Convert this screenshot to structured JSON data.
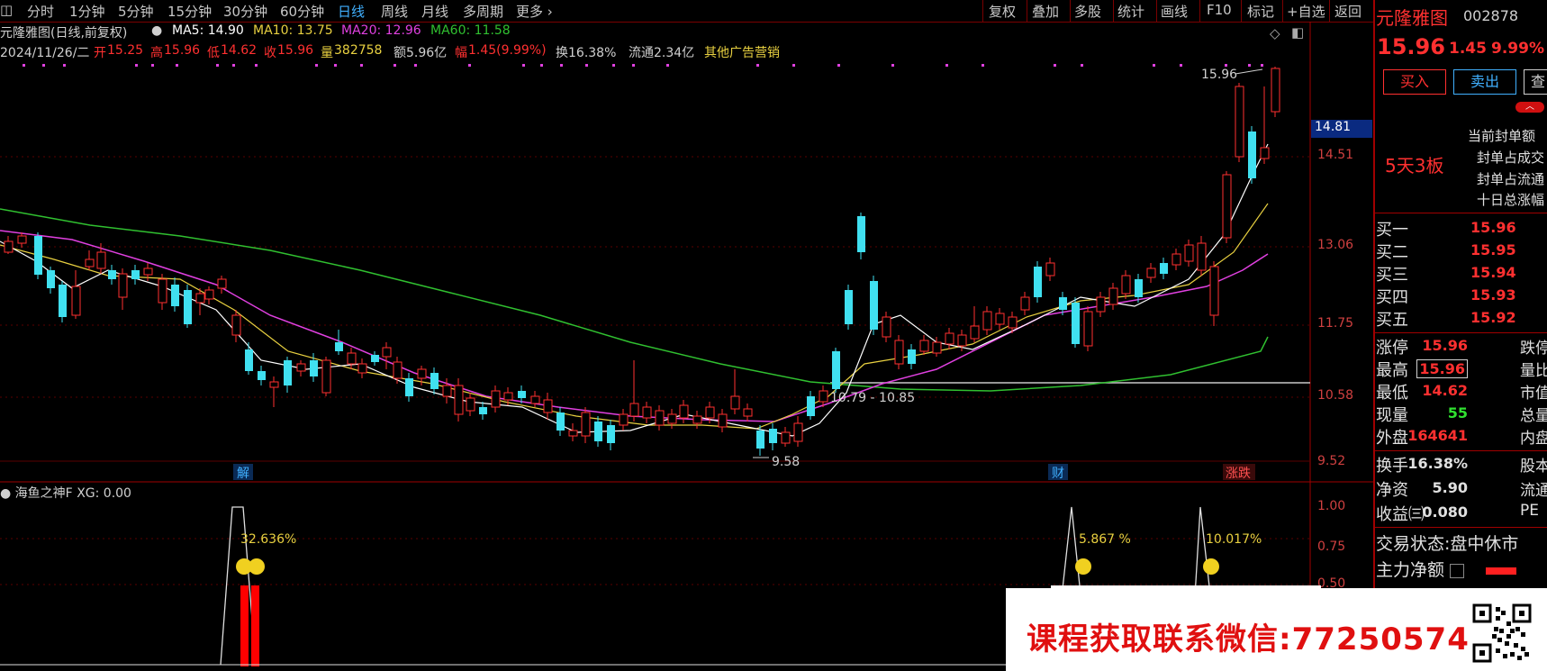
{
  "topbar": {
    "periods": [
      "分时",
      "1分钟",
      "5分钟",
      "15分钟",
      "30分钟",
      "60分钟",
      "日线",
      "周线",
      "月线",
      "多周期",
      "更多"
    ],
    "active_period": "日线",
    "tools": [
      "复权",
      "叠加",
      "多股",
      "统计",
      "画线",
      "F10",
      "标记",
      "+自选",
      "返回"
    ]
  },
  "legend": {
    "name": "元隆雅图(日线,前复权)",
    "ma5": "MA5: 14.90",
    "ma10": "MA10: 13.75",
    "ma20": "MA20: 12.96",
    "ma60": "MA60: 11.58"
  },
  "info": {
    "date": "2024/11/26/二",
    "open_label": "开",
    "open": "15.25",
    "high_label": "高",
    "high": "15.96",
    "low_label": "低",
    "low": "14.62",
    "close_label": "收",
    "close": "15.96",
    "vol_label": "量",
    "vol": "382758",
    "amount": "额5.96亿",
    "change_label": "幅",
    "change": "1.45(9.99%)",
    "turnover": "换16.38%",
    "float": "流通2.34亿",
    "ad": "其他广告营销"
  },
  "price_axis": {
    "ticks": [
      "14.51",
      "13.06",
      "11.75",
      "10.58",
      "9.52"
    ],
    "current": "14.81"
  },
  "annotations": {
    "high_label": "15.96",
    "low_label": "9.58",
    "range_label": "10.79 - 10.85",
    "markers": [
      "解",
      "财",
      "涨跌"
    ]
  },
  "indicator": {
    "name": "海鱼之神F",
    "value": "XG: 0.00",
    "ticks": [
      "1.00",
      "0.75",
      "0.50"
    ],
    "labels": [
      "32.636%",
      "5.867 %",
      "10.017%"
    ]
  },
  "right_panel": {
    "stock_name": "元隆雅图",
    "stock_code": "002878",
    "price": "15.96",
    "change": "1.45",
    "change_pct": "9.99%",
    "buy_button": "买入",
    "sell_button": "卖出",
    "more_button": "查",
    "limit_info": {
      "board": "5天3板",
      "lines": [
        "当前封单额",
        "封单占成交",
        "封单占流通",
        "十日总涨幅"
      ]
    },
    "bids": [
      {
        "label": "买一",
        "price": "15.96"
      },
      {
        "label": "买二",
        "price": "15.95"
      },
      {
        "label": "买三",
        "price": "15.94"
      },
      {
        "label": "买四",
        "price": "15.93"
      },
      {
        "label": "买五",
        "price": "15.92"
      }
    ],
    "stats": [
      {
        "label": "涨停",
        "value": "15.96",
        "label2": "跌停"
      },
      {
        "label": "最高",
        "value": "15.96",
        "label2": "量比"
      },
      {
        "label": "最低",
        "value": "14.62",
        "label2": "市值"
      },
      {
        "label": "现量",
        "value": "55",
        "label2": "总量"
      },
      {
        "label": "外盘",
        "value": "164641",
        "label2": "内盘"
      }
    ],
    "stats2": [
      {
        "label": "换手",
        "value": "16.38%",
        "label2": "股本"
      },
      {
        "label": "净资",
        "value": "5.90",
        "label2": "流通"
      },
      {
        "label": "收益㈢",
        "value": "0.080",
        "label2": "PE"
      }
    ],
    "trade_status_label": "交易状态:",
    "trade_status": "盘中休市",
    "main_net_label": "主力净额"
  },
  "banner": {
    "text": "课程获取联系微信:77250574"
  },
  "colors": {
    "up": "#ff3030",
    "down": "#40e0f0",
    "ma5": "#ffffff",
    "ma10": "#e8d040",
    "ma20": "#e040e0",
    "ma60": "#30c030",
    "accent_blue": "#40b0ff"
  }
}
